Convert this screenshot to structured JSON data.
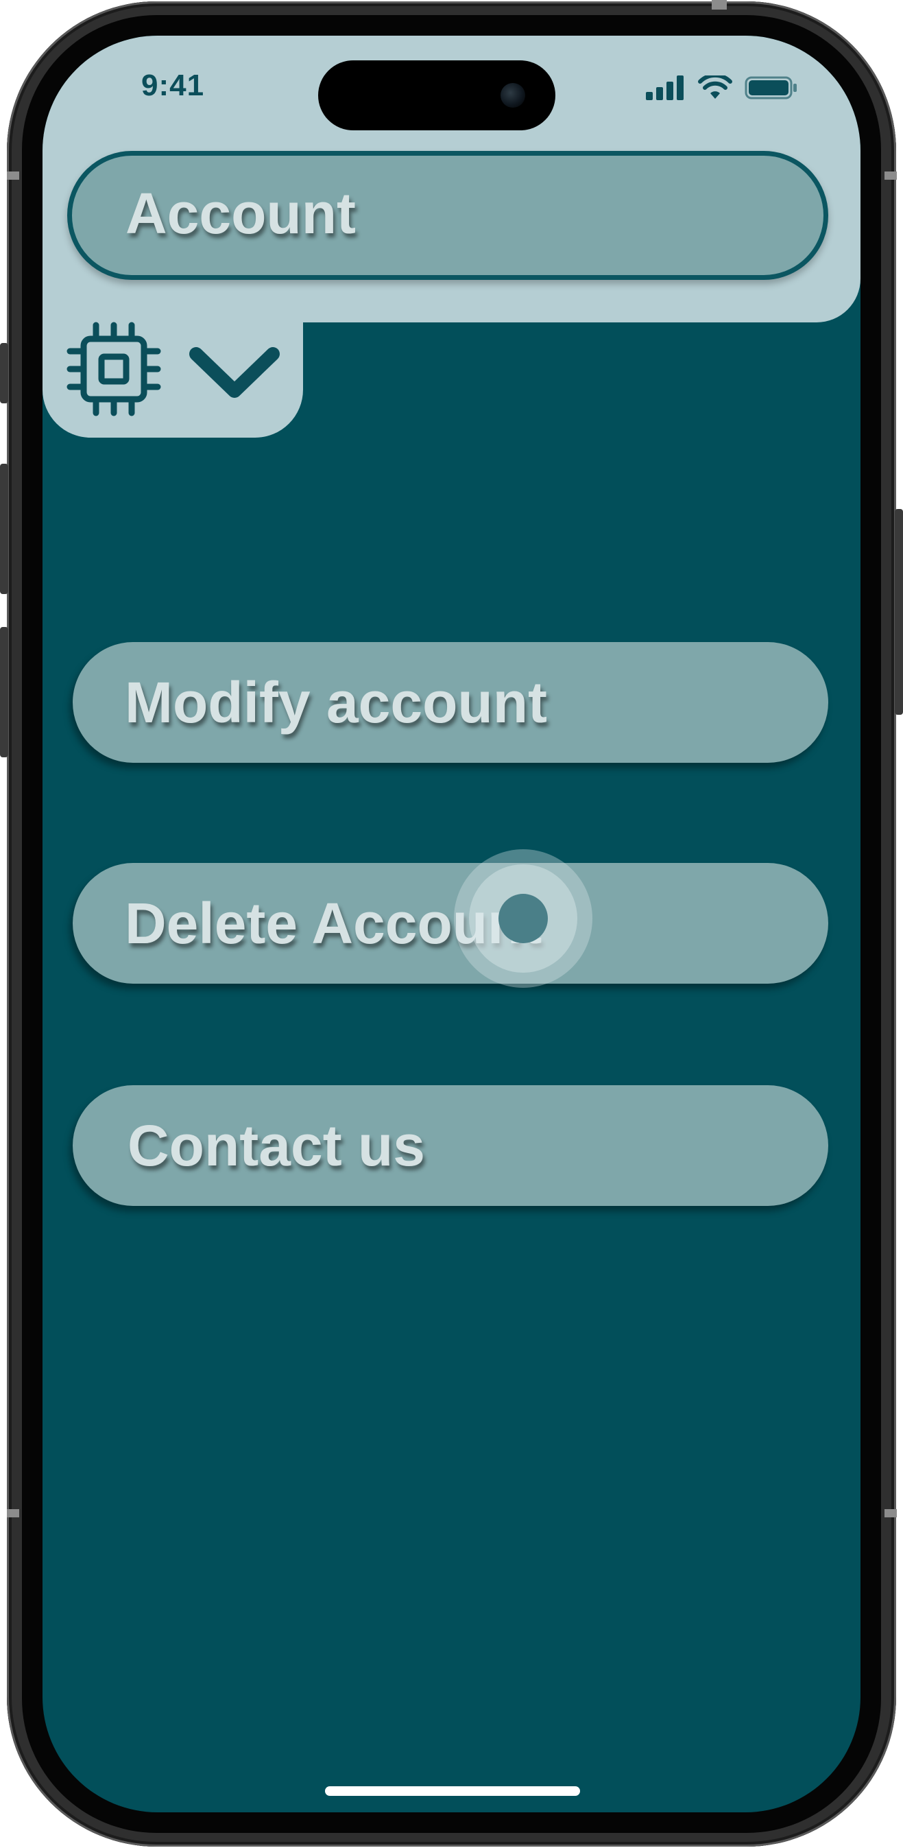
{
  "status_bar": {
    "time": "9:41",
    "icons": [
      "signal-icon",
      "wifi-icon",
      "battery-icon"
    ]
  },
  "header": {
    "title": "Account",
    "icons": [
      "chip-icon",
      "chevron-down-icon"
    ]
  },
  "menu": {
    "items": [
      {
        "label": "Modify account"
      },
      {
        "label": "Delete Account"
      },
      {
        "label": "Contact us"
      }
    ]
  },
  "colors": {
    "background": "#024f5a",
    "panel": "#b5ced3",
    "button": "#7fa7aa",
    "button_text": "#d6e2e3",
    "accent_dark": "#0b4e5a"
  }
}
